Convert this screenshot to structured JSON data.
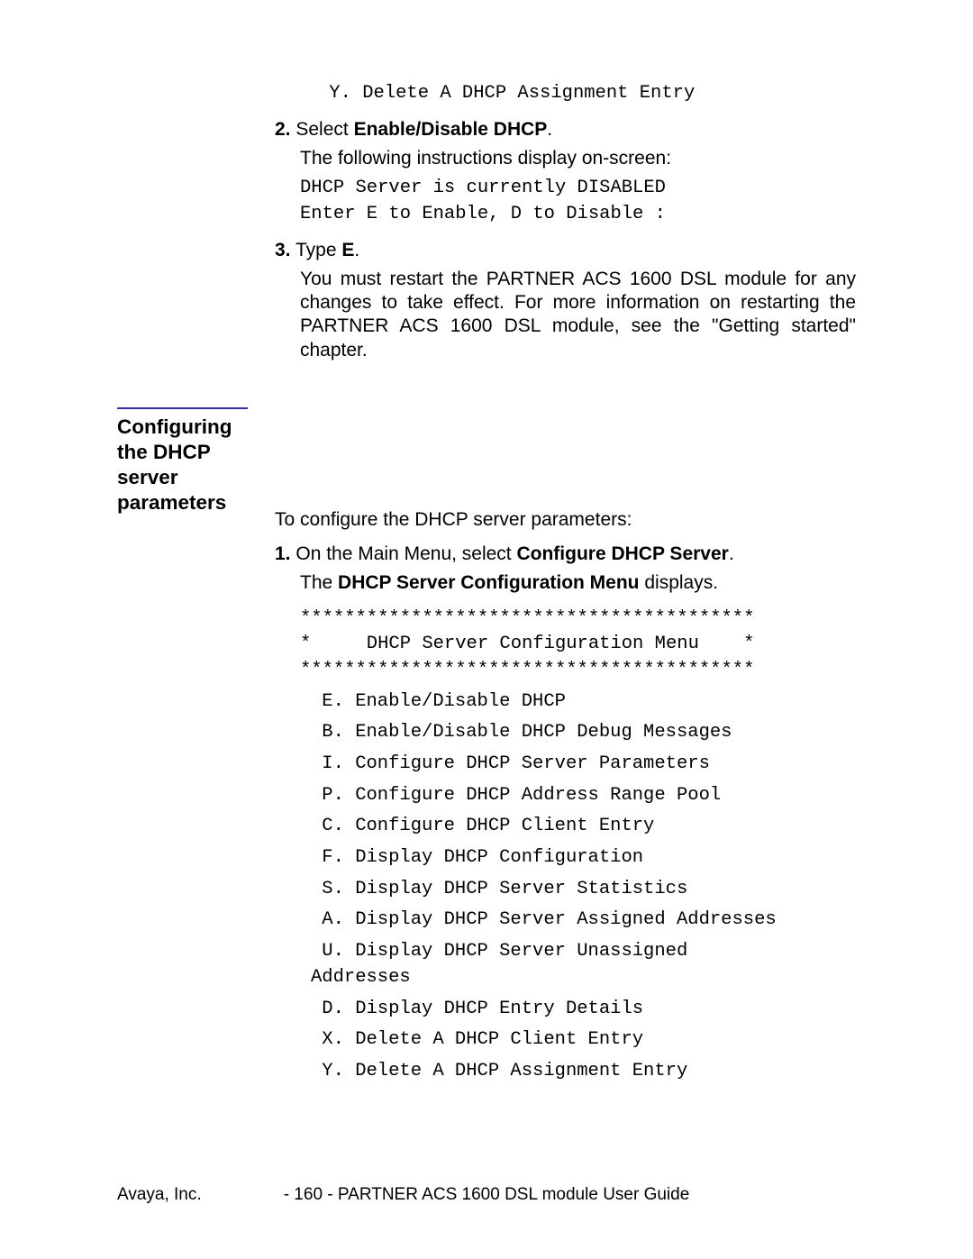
{
  "top": {
    "mono_line": " Y. Delete A DHCP Assignment Entry",
    "step2_num": "2.",
    "step2_prefix": "Select ",
    "step2_bold": "Enable/Disable DHCP",
    "step2_suffix": ".",
    "step2_follow": "The following instructions display on-screen:",
    "mono_disabled": "DHCP Server is currently DISABLED",
    "mono_prompt": "Enter E to Enable, D to Disable :",
    "step3_num": "3.",
    "step3_prefix": "Type ",
    "step3_bold": "E",
    "step3_suffix": ".",
    "step3_para": "You must restart the PARTNER ACS 1600 DSL module for any changes to take effect.  For more information on restarting the PARTNER ACS 1600 DSL module, see the \"Getting started\" chapter."
  },
  "section": {
    "heading": "Configuring the DHCP server parameters",
    "intro": "To configure the DHCP server parameters:",
    "step1_num": "1.",
    "step1_prefix": "On the Main Menu, select ",
    "step1_bold": "Configure DHCP Server",
    "step1_suffix": ".",
    "step1_line2_prefix": "The ",
    "step1_line2_bold": "DHCP Server Configuration Menu",
    "step1_line2_suffix": " displays.",
    "menu_border": "*****************************************",
    "menu_title": "*     DHCP Server Configuration Menu    *",
    "items": {
      "e": " E. Enable/Disable DHCP",
      "b": " B. Enable/Disable DHCP Debug Messages",
      "i": " I. Configure DHCP Server Parameters",
      "p": " P. Configure DHCP Address Range Pool",
      "c": " C. Configure DHCP Client Entry",
      "f": " F. Display DHCP Configuration",
      "s": " S. Display DHCP Server Statistics",
      "a": " A. Display DHCP Server Assigned Addresses",
      "u1": " U. Display DHCP Server Unassigned",
      "u2": "Addresses",
      "d": " D. Display DHCP Entry Details",
      "x": " X. Delete A DHCP Client Entry",
      "y": " Y. Delete A DHCP Assignment Entry"
    }
  },
  "footer": {
    "left": "Avaya, Inc.",
    "center": "- 160 -",
    "right": "PARTNER ACS 1600 DSL module User Guide"
  }
}
